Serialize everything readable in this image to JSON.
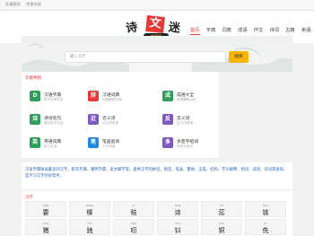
{
  "topbar": {
    "links": [
      "弘扬国学",
      "传承文化"
    ]
  },
  "logo": {
    "chars": [
      "诗",
      "文",
      "迷"
    ],
    "sub": "字典网"
  },
  "nav": {
    "items": [
      "首页",
      "字典",
      "词典",
      "成语",
      "作文",
      "诗词",
      "古籍",
      "英语"
    ],
    "active_index": 0
  },
  "search": {
    "placeholder": "输入汉字",
    "button": "搜索"
  },
  "tools": {
    "title": "功能导航",
    "items": [
      {
        "name": "汉语字典",
        "desc": "新华字典在线",
        "icon": "book-icon",
        "color": "#2e9e5b",
        "glyph": "D"
      },
      {
        "name": "汉语词典",
        "desc": "词语解释查询",
        "icon": "dictionary-icon",
        "color": "#e53935",
        "glyph": "辞"
      },
      {
        "name": "成语大全",
        "desc": "成语解释出处",
        "icon": "idiom-icon",
        "color": "#2e9e5b",
        "glyph": "成"
      },
      {
        "name": "诗词名句",
        "desc": "唐诗宋词元曲",
        "icon": "poem-icon",
        "color": "#2e9e5b",
        "glyph": "诗"
      },
      {
        "name": "近义词",
        "desc": "近义词查询",
        "icon": "synonym-icon",
        "color": "#7e57c2",
        "glyph": "近"
      },
      {
        "name": "反义词",
        "desc": "反义词查询",
        "icon": "antonym-icon",
        "color": "#7e57c2",
        "glyph": "反"
      },
      {
        "name": "英语词典",
        "desc": "英汉互译",
        "icon": "english-icon",
        "color": "#2e9e5b",
        "glyph": "英"
      },
      {
        "name": "笔画查询",
        "desc": "汉字笔画",
        "icon": "stroke-icon",
        "color": "#1e88e5",
        "glyph": "笔"
      },
      {
        "name": "多音字组词",
        "desc": "多音字组词",
        "icon": "polyphone-icon",
        "color": "#7e57c2",
        "glyph": "多"
      }
    ]
  },
  "intro": {
    "text": "汉语字典收录最多的汉字，新华字典、康熙字典、说文解字等，提供汉字的拼音、部首、笔画、繁体、五笔、结构、字义解释、组词、成语、诗词等查询，是学习汉字的好帮手。"
  },
  "hanzi": {
    "title": "汉字",
    "row1": [
      {
        "py": "yao",
        "ch": "要"
      },
      {
        "py": "bang",
        "ch": "榛"
      },
      {
        "py": "ji",
        "ch": "秸"
      },
      {
        "py": "ting",
        "ch": "诗"
      },
      {
        "py": "rui",
        "ch": "蕊"
      },
      {
        "py": "tiao",
        "ch": "铫"
      }
    ],
    "row2": [
      {
        "py": "zhu",
        "ch": "猪"
      },
      {
        "py": "chi",
        "ch": "驰"
      },
      {
        "py": "dao",
        "ch": "叨"
      },
      {
        "py": "tou",
        "ch": "钭"
      },
      {
        "py": "hou",
        "ch": "铜"
      },
      {
        "py": "pi",
        "ch": "侁"
      }
    ]
  }
}
